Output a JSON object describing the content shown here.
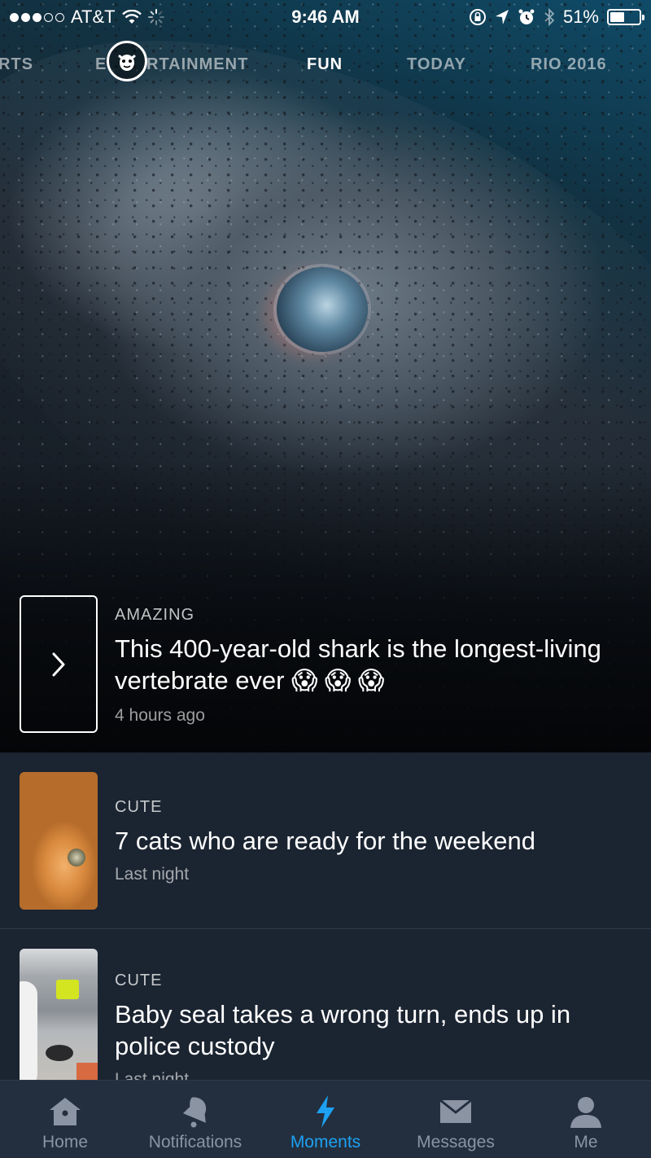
{
  "status_bar": {
    "carrier": "AT&T",
    "time": "9:46 AM",
    "battery": "51%",
    "battery_level": 0.51
  },
  "category_tabs": [
    {
      "label": "RTS"
    },
    {
      "label": "E"
    },
    {
      "label": "RTAINMENT"
    },
    {
      "label": "FUN",
      "active": true
    },
    {
      "label": "TODAY"
    },
    {
      "label": "RIO 2016"
    }
  ],
  "hero": {
    "category": "AMAZING",
    "headline": "This 400-year-old shark is the longest-living vertebrate ever 😱 😱 😱",
    "time": "4 hours ago"
  },
  "stories": [
    {
      "category": "CUTE",
      "headline": "7 cats who are ready for the weekend",
      "time": "Last night",
      "thumb": "cat-photo"
    },
    {
      "category": "CUTE",
      "headline": "Baby seal takes a wrong turn, ends up in police custody",
      "time": "Last night",
      "thumb": "seal-photo"
    }
  ],
  "tabbar": {
    "items": [
      {
        "label": "Home",
        "icon": "home-icon"
      },
      {
        "label": "Notifications",
        "icon": "bell-icon"
      },
      {
        "label": "Moments",
        "icon": "lightning-icon",
        "active": true
      },
      {
        "label": "Messages",
        "icon": "envelope-icon"
      },
      {
        "label": "Me",
        "icon": "person-icon"
      }
    ]
  },
  "colors": {
    "accent": "#1da1f2",
    "background": "#1b2431",
    "tabbar": "#232f3e",
    "inactive": "#8a94a2"
  }
}
